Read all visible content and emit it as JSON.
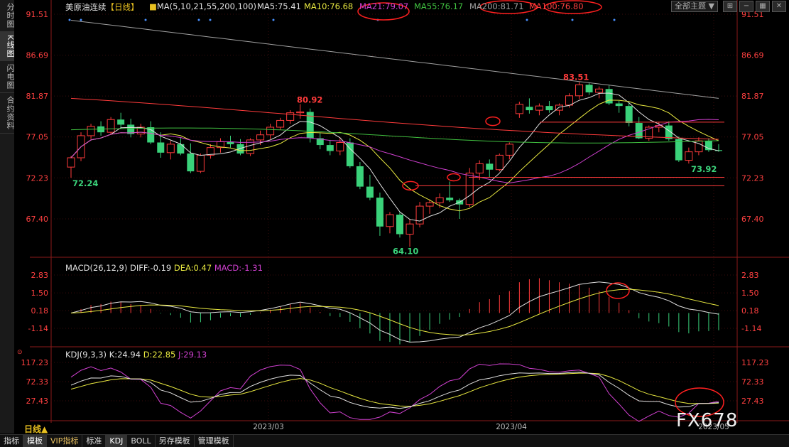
{
  "sidebar": {
    "tabs": [
      {
        "label": "分时图",
        "active": false
      },
      {
        "label": "K线图",
        "active": true
      },
      {
        "label": "闪电图",
        "active": false
      },
      {
        "label": "合约资料",
        "active": false
      }
    ]
  },
  "header": {
    "instrument": "美原油连续",
    "period_tag": "【日线】",
    "ma_params": "MA(5,10,21,55,200,100)",
    "ma5": "MA5:75.41",
    "ma10": "MA10:76.68",
    "ma21": "MA21:79.07",
    "ma55": "MA55:76.17",
    "ma200": "MA200:81.71",
    "ma100": "MA100:76.80",
    "theme_select": "全部主题"
  },
  "colors": {
    "up": "#ff3b3b",
    "down": "#3ad27a",
    "ma5": "#e0e0e0",
    "ma10": "#e8e840",
    "ma21": "#d040d0",
    "ma55": "#40c040",
    "ma200": "#a0a0a0",
    "ma100": "#ff3b3b",
    "axis_text": "#ff4040",
    "highlight_circle": "#ff2020"
  },
  "chart_data": [
    {
      "type": "candlestick",
      "title": "美原油连续 日线",
      "y_ticks": [
        "91.51",
        "86.69",
        "81.87",
        "77.05",
        "72.23",
        "67.40"
      ],
      "ylim": [
        64.1,
        91.51
      ],
      "x_labels": [
        "2023/03",
        "2023/04",
        "2023/05"
      ],
      "annotations": [
        "72.24",
        "80.92",
        "64.10",
        "83.51",
        "73.92"
      ],
      "candles": [
        [
          73.5,
          74.8,
          72.24,
          74.6
        ],
        [
          74.6,
          77.6,
          74.2,
          77.2
        ],
        [
          77.2,
          78.6,
          76.8,
          78.3
        ],
        [
          78.3,
          78.9,
          77.2,
          77.6
        ],
        [
          77.6,
          79.4,
          77.3,
          79.1
        ],
        [
          79.1,
          79.9,
          78.0,
          78.5
        ],
        [
          78.5,
          79.2,
          77.0,
          77.4
        ],
        [
          77.4,
          78.6,
          77.0,
          78.2
        ],
        [
          78.2,
          78.9,
          76.2,
          76.4
        ],
        [
          76.4,
          77.6,
          74.6,
          75.2
        ],
        [
          75.2,
          76.6,
          74.4,
          76.2
        ],
        [
          76.2,
          77.0,
          74.9,
          75.1
        ],
        [
          75.1,
          76.3,
          72.8,
          73.0
        ],
        [
          73.0,
          75.1,
          72.8,
          74.9
        ],
        [
          74.9,
          76.2,
          74.5,
          75.8
        ],
        [
          75.8,
          76.9,
          75.2,
          76.5
        ],
        [
          76.5,
          77.2,
          75.8,
          76.2
        ],
        [
          76.2,
          76.8,
          74.9,
          75.1
        ],
        [
          75.1,
          76.9,
          74.8,
          76.7
        ],
        [
          76.7,
          77.8,
          76.1,
          77.3
        ],
        [
          77.3,
          78.6,
          76.8,
          78.2
        ],
        [
          78.2,
          79.3,
          77.9,
          79.0
        ],
        [
          79.0,
          80.2,
          78.6,
          79.9
        ],
        [
          79.9,
          80.92,
          79.2,
          80.0
        ],
        [
          80.0,
          80.4,
          76.4,
          76.9
        ],
        [
          76.9,
          77.5,
          75.6,
          76.1
        ],
        [
          76.1,
          76.7,
          74.9,
          75.4
        ],
        [
          75.4,
          76.9,
          74.9,
          76.4
        ],
        [
          76.4,
          76.9,
          73.4,
          73.6
        ],
        [
          73.6,
          74.1,
          70.9,
          71.2
        ],
        [
          71.2,
          72.6,
          69.6,
          69.9
        ],
        [
          69.9,
          70.5,
          65.4,
          66.5
        ],
        [
          66.5,
          68.2,
          65.7,
          67.9
        ],
        [
          67.9,
          68.2,
          65.2,
          65.6
        ],
        [
          65.6,
          67.4,
          64.1,
          66.8
        ],
        [
          66.8,
          69.4,
          66.4,
          68.9
        ],
        [
          68.9,
          69.7,
          68.0,
          69.3
        ],
        [
          69.3,
          70.4,
          68.7,
          69.9
        ],
        [
          69.9,
          71.8,
          69.4,
          69.6
        ],
        [
          69.6,
          69.8,
          67.4,
          69.1
        ],
        [
          69.1,
          73.4,
          68.8,
          72.8
        ],
        [
          72.8,
          74.3,
          72.0,
          73.9
        ],
        [
          73.9,
          74.4,
          72.3,
          73.2
        ],
        [
          73.2,
          75.1,
          73.0,
          74.9
        ],
        [
          74.9,
          76.4,
          74.4,
          76.2
        ],
        [
          79.8,
          81.2,
          79.3,
          80.9
        ],
        [
          80.6,
          81.6,
          79.8,
          80.2
        ],
        [
          80.2,
          81.0,
          79.6,
          80.7
        ],
        [
          80.7,
          81.3,
          79.9,
          80.2
        ],
        [
          80.2,
          81.0,
          79.6,
          80.8
        ],
        [
          80.8,
          82.2,
          80.5,
          81.9
        ],
        [
          81.9,
          83.51,
          81.5,
          83.2
        ],
        [
          83.2,
          83.4,
          82.0,
          82.3
        ],
        [
          82.3,
          83.0,
          81.6,
          82.7
        ],
        [
          82.7,
          83.1,
          80.8,
          81.0
        ],
        [
          81.0,
          81.3,
          79.9,
          80.7
        ],
        [
          80.7,
          81.1,
          78.3,
          78.7
        ],
        [
          78.7,
          79.4,
          76.8,
          76.9
        ],
        [
          76.9,
          78.4,
          76.6,
          78.2
        ],
        [
          78.2,
          78.8,
          77.6,
          78.4
        ],
        [
          78.4,
          78.9,
          76.6,
          76.8
        ],
        [
          76.8,
          77.1,
          74.1,
          74.3
        ],
        [
          74.3,
          75.8,
          73.92,
          75.3
        ],
        [
          75.3,
          77.0,
          74.9,
          76.6
        ],
        [
          76.6,
          76.9,
          75.3,
          75.5
        ],
        [
          75.5,
          76.2,
          75.3,
          75.4
        ]
      ]
    },
    {
      "type": "bar",
      "title": "MACD(26,12,9)",
      "diff": "DIFF:-0.19",
      "dea": "DEA:0.47",
      "macd": "MACD:-1.31",
      "y_ticks": [
        "2.83",
        "1.50",
        "0.18",
        "-1.14"
      ]
    },
    {
      "type": "line",
      "title": "KDJ(9,3,3)",
      "k": "K:24.94",
      "d": "D:22.85",
      "j": "J:29.13",
      "y_ticks": [
        "117.23",
        "72.33",
        "27.43"
      ]
    }
  ],
  "bottom_bar": {
    "period": "日线▲",
    "tabs": [
      {
        "label": "指标",
        "active": false,
        "vip": false
      },
      {
        "label": "模板",
        "active": true,
        "vip": false
      },
      {
        "label": "VIP指标",
        "active": false,
        "vip": true
      },
      {
        "label": "标准",
        "active": false,
        "vip": false
      },
      {
        "label": "KDJ",
        "active": true,
        "vip": false
      },
      {
        "label": "BOLL",
        "active": false,
        "vip": false
      },
      {
        "label": "另存模板",
        "active": false,
        "vip": false
      },
      {
        "label": "管理模板",
        "active": false,
        "vip": false
      }
    ]
  },
  "watermark": "FX678"
}
